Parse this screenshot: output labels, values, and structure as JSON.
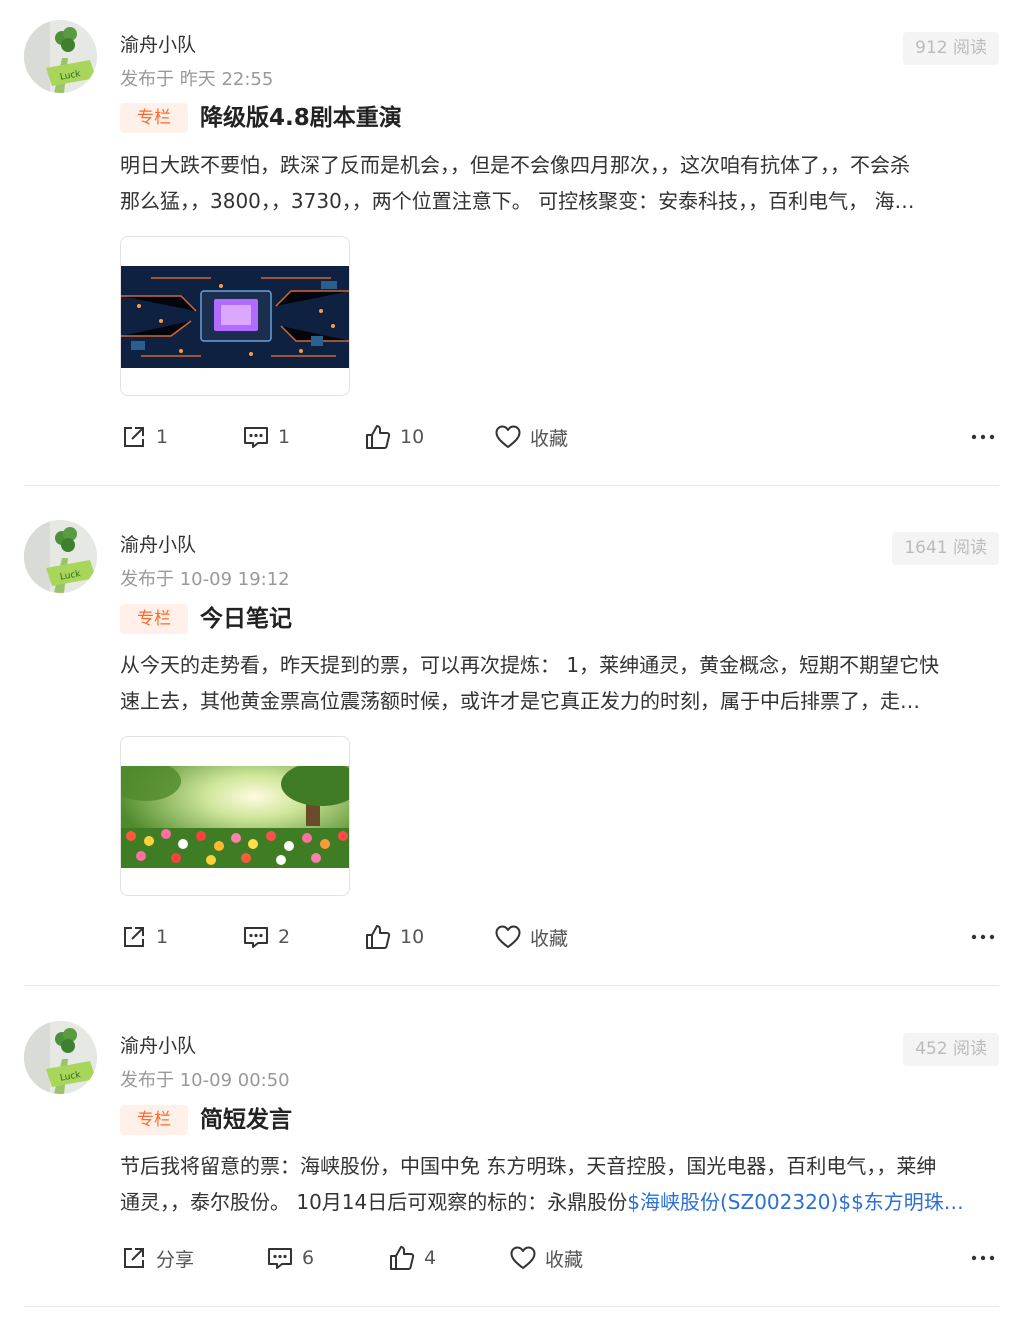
{
  "posts": [
    {
      "author": "渝舟小队",
      "time": "发布于 昨天 22:55",
      "reads": "912 阅读",
      "tag": "专栏",
      "title": "降级版4.8剧本重演",
      "body_line1": "明日大跌不要怕，跌深了反而是机会，，但是不会像四月那次，，这次咱有抗体了，，不会杀",
      "body_line2": "那么猛，，3800，，3730，，两个位置注意下。 可控核聚变：安泰科技，，百利电气， 海…",
      "share": "1",
      "comments": "1",
      "likes": "10",
      "favorite": "收藏"
    },
    {
      "author": "渝舟小队",
      "time": "发布于 10-09 19:12",
      "reads": "1641 阅读",
      "tag": "专栏",
      "title": "今日笔记",
      "body_line1": "从今天的走势看，昨天提到的票，可以再次提炼： 1，莱绅通灵，黄金概念，短期不期望它快",
      "body_line2": "速上去，其他黄金票高位震荡额时候，或许才是它真正发力的时刻，属于中后排票了，走…",
      "share": "1",
      "comments": "2",
      "likes": "10",
      "favorite": "收藏"
    },
    {
      "author": "渝舟小队",
      "time": "发布于 10-09 00:50",
      "reads": "452 阅读",
      "tag": "专栏",
      "title": "简短发言",
      "body_line1": "节后我将留意的票：海峡股份，中国中免 东方明珠，天音控股，国光电器，百利电气，，莱绅",
      "body_line2_plain": "通灵，，泰尔股份。 10月14日后可观察的标的：永鼎股份",
      "body_line2_link": "$海峡股份(SZ002320)$$东方明珠…",
      "share": "分享",
      "comments": "6",
      "likes": "4",
      "favorite": "收藏"
    }
  ],
  "icons": {
    "share": "share-icon",
    "comment": "comment-icon",
    "like": "thumbs-up-icon",
    "favorite": "heart-icon",
    "more": "more-icon"
  },
  "colors": {
    "tag_text": "#ff6a2a",
    "tag_bg": "#fff1ea",
    "link": "#2b6fd6"
  }
}
